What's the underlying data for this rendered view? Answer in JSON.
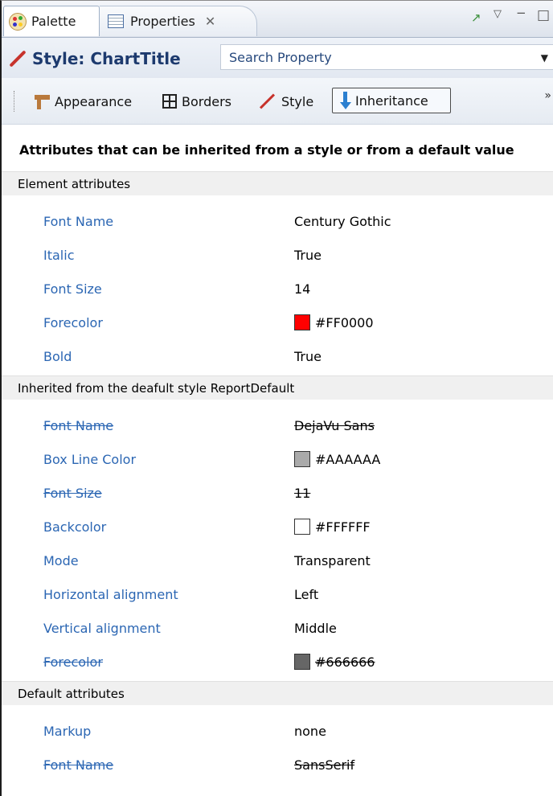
{
  "tabs": {
    "palette": "Palette",
    "properties": "Properties",
    "close_glyph": "✕"
  },
  "header": {
    "title": "Style: ChartTitle",
    "search_placeholder": "Search Property"
  },
  "sections": [
    {
      "label": "Appearance",
      "icon": "appearance-icon"
    },
    {
      "label": "Borders",
      "icon": "borders-icon"
    },
    {
      "label": "Style",
      "icon": "style-icon"
    },
    {
      "label": "Inheritance",
      "icon": "inheritance-icon",
      "selected": true
    }
  ],
  "heading": "Attributes that can be inherited from a style or from a default value",
  "groups": {
    "element": "Element attributes",
    "inherited": "Inherited from the deafult style ReportDefault",
    "default": "Default attributes"
  },
  "element_rows": [
    {
      "name": "Font Name",
      "value": "Century Gothic"
    },
    {
      "name": "Italic",
      "value": "True"
    },
    {
      "name": "Font Size",
      "value": "14"
    },
    {
      "name": "Forecolor",
      "value": "#FF0000",
      "color": "#FF0000"
    },
    {
      "name": "Bold",
      "value": "True"
    }
  ],
  "inherited_rows": [
    {
      "name": "Font Name",
      "value": "DejaVu Sans",
      "overridden": true
    },
    {
      "name": "Box Line Color",
      "value": "#AAAAAA",
      "color": "#AAAAAA"
    },
    {
      "name": "Font Size",
      "value": "11",
      "overridden": true
    },
    {
      "name": "Backcolor",
      "value": "#FFFFFF",
      "color": "#FFFFFF"
    },
    {
      "name": "Mode",
      "value": "Transparent"
    },
    {
      "name": "Horizontal alignment",
      "value": "Left"
    },
    {
      "name": "Vertical alignment",
      "value": "Middle"
    },
    {
      "name": "Forecolor",
      "value": "#666666",
      "color": "#666666",
      "overridden": true
    }
  ],
  "default_rows": [
    {
      "name": "Markup",
      "value": "none"
    },
    {
      "name": "Font Name",
      "value": "SansSerif",
      "overridden": true
    }
  ],
  "colors": {
    "name_link": "#2b66b3",
    "title": "#1d3a6e"
  }
}
